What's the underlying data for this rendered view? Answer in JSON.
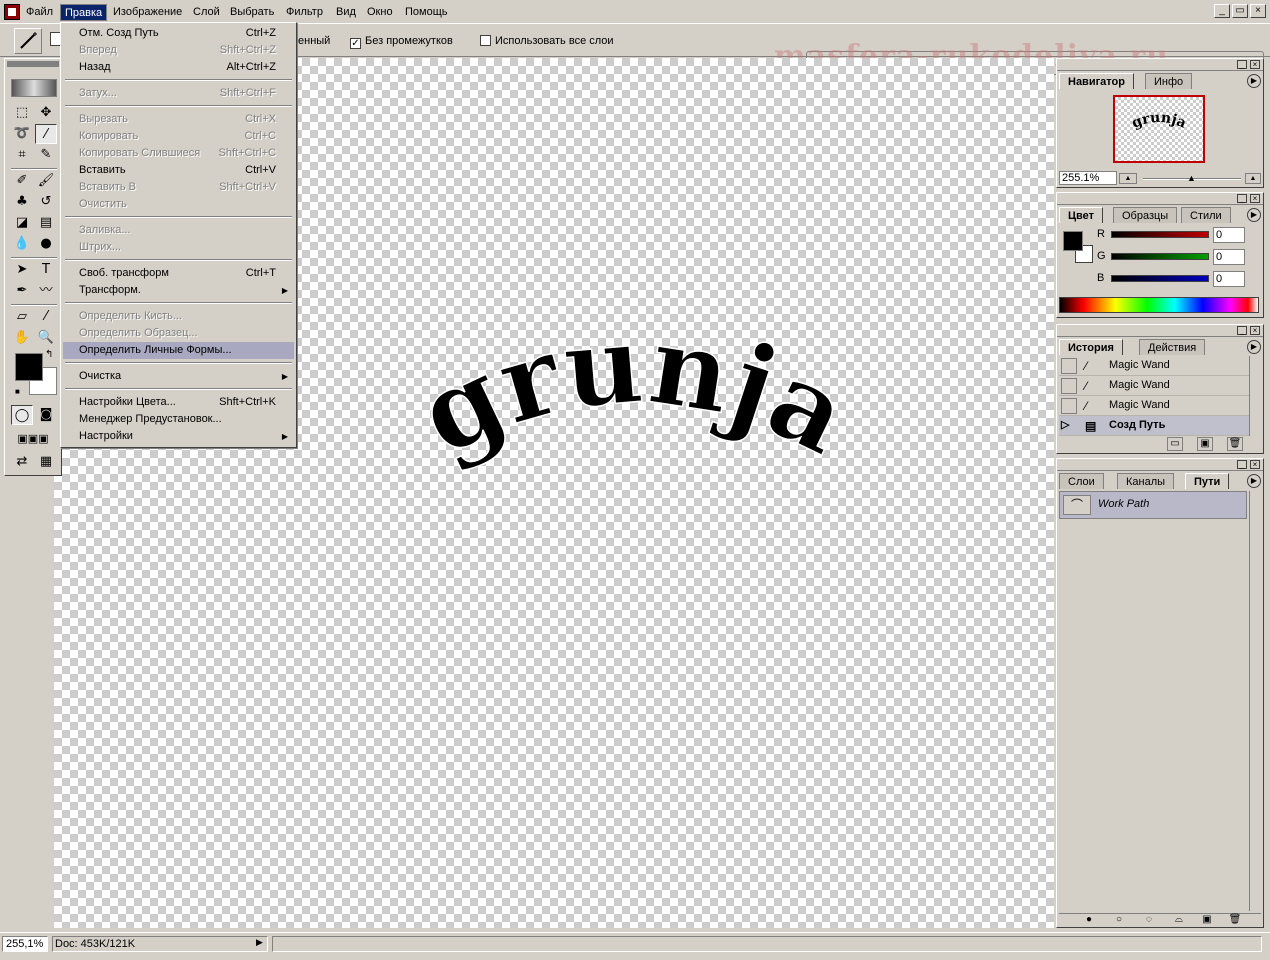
{
  "menubar": {
    "items": [
      "Файл",
      "Правка",
      "Изображение",
      "Слой",
      "Выбрать",
      "Фильтр",
      "Вид",
      "Окно",
      "Помощь"
    ],
    "active": "Правка",
    "window_buttons": [
      "_",
      "▭",
      "×"
    ]
  },
  "options_bar": {
    "partial_label": "енный",
    "contiguous": {
      "label": "Без промежутков",
      "checked": true
    },
    "all_layers": {
      "label": "Использовать все слои",
      "checked": false
    },
    "watermark": "masfera-rukodeliya.ru"
  },
  "edit_menu": {
    "groups": [
      [
        {
          "label": "Отм. Созд Путь",
          "shortcut": "Ctrl+Z",
          "enabled": true
        },
        {
          "label": "Вперед",
          "shortcut": "Shft+Ctrl+Z",
          "enabled": false
        },
        {
          "label": "Назад",
          "shortcut": "Alt+Ctrl+Z",
          "enabled": true
        }
      ],
      [
        {
          "label": "Затух...",
          "shortcut": "Shft+Ctrl+F",
          "enabled": false
        }
      ],
      [
        {
          "label": "Вырезать",
          "shortcut": "Ctrl+X",
          "enabled": false
        },
        {
          "label": "Копировать",
          "shortcut": "Ctrl+C",
          "enabled": false
        },
        {
          "label": "Копировать Слившиеся",
          "shortcut": "Shft+Ctrl+C",
          "enabled": false
        },
        {
          "label": "Вставить",
          "shortcut": "Ctrl+V",
          "enabled": true
        },
        {
          "label": "Вставить В",
          "shortcut": "Shft+Ctrl+V",
          "enabled": false
        },
        {
          "label": "Очистить",
          "shortcut": "",
          "enabled": false
        }
      ],
      [
        {
          "label": "Заливка...",
          "shortcut": "",
          "enabled": false
        },
        {
          "label": "Штрих...",
          "shortcut": "",
          "enabled": false
        }
      ],
      [
        {
          "label": "Своб. трансформ",
          "shortcut": "Ctrl+T",
          "enabled": true
        },
        {
          "label": "Трансформ.",
          "shortcut": "",
          "enabled": true,
          "submenu": true
        }
      ],
      [
        {
          "label": "Определить Кисть...",
          "shortcut": "",
          "enabled": false
        },
        {
          "label": "Определить Образец...",
          "shortcut": "",
          "enabled": false
        },
        {
          "label": "Определить Личные Формы...",
          "shortcut": "",
          "enabled": true,
          "highlighted": true
        }
      ],
      [
        {
          "label": "Очистка",
          "shortcut": "",
          "enabled": true,
          "submenu": true
        }
      ],
      [
        {
          "label": "Настройки Цвета...",
          "shortcut": "Shft+Ctrl+K",
          "enabled": true
        },
        {
          "label": "Менеджер Предустановок...",
          "shortcut": "",
          "enabled": true
        },
        {
          "label": "Настройки",
          "shortcut": "",
          "enabled": true,
          "submenu": true
        }
      ]
    ]
  },
  "canvas": {
    "text": "grunja",
    "text_color": "#000000"
  },
  "navigator_palette": {
    "tabs": [
      "Навигатор",
      "Инфо"
    ],
    "active_tab": "Навигатор",
    "zoom": "255.1%",
    "thumb_text": "grunja"
  },
  "color_palette": {
    "tabs": [
      "Цвет",
      "Образцы",
      "Стили"
    ],
    "active_tab": "Цвет",
    "channels": [
      {
        "label": "R",
        "value": "0",
        "color": "#c00000"
      },
      {
        "label": "G",
        "value": "0",
        "color": "#00a000"
      },
      {
        "label": "B",
        "value": "0",
        "color": "#0000c0"
      }
    ]
  },
  "history_palette": {
    "tabs": [
      "История",
      "Действия"
    ],
    "active_tab": "История",
    "items": [
      {
        "label": "Magic Wand",
        "icon": "magic-wand-icon"
      },
      {
        "label": "Magic Wand",
        "icon": "magic-wand-icon"
      },
      {
        "label": "Magic Wand",
        "icon": "magic-wand-icon"
      },
      {
        "label": "Созд Путь",
        "icon": "path-icon",
        "selected": true
      }
    ]
  },
  "layers_palette": {
    "tabs": [
      "Слои",
      "Каналы",
      "Пути"
    ],
    "active_tab": "Пути",
    "paths": [
      {
        "label": "Work Path"
      }
    ]
  },
  "statusbar": {
    "zoom": "255,1%",
    "doc": "Doc: 453K/121K"
  }
}
